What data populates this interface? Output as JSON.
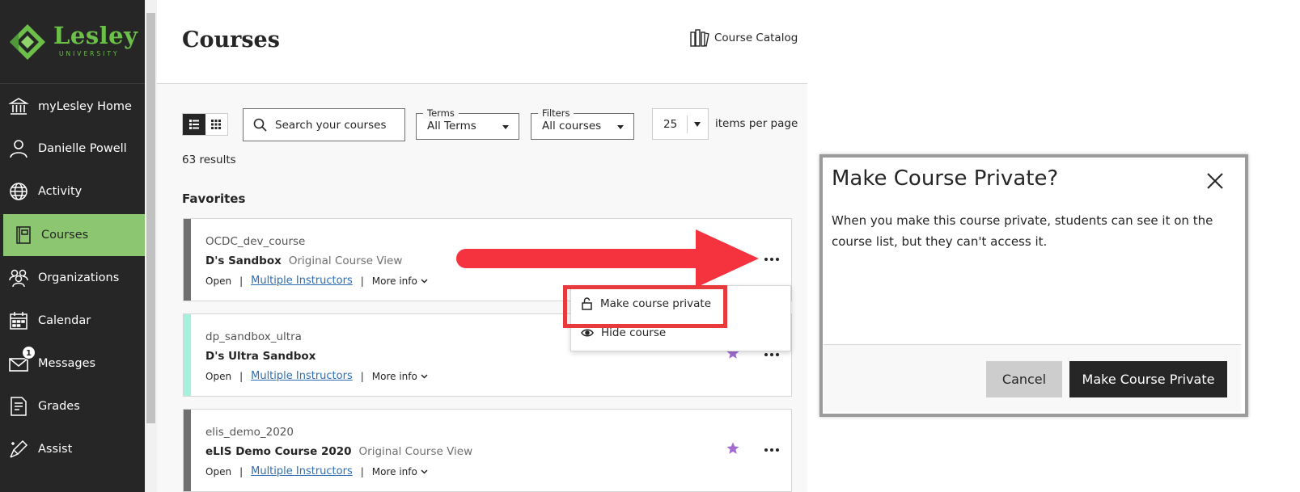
{
  "brand": {
    "name": "Lesley",
    "subname": "UNIVERSITY",
    "accent": "#6cc04a"
  },
  "sidebar": {
    "items": [
      {
        "label": "myLesley Home",
        "icon": "institution-icon"
      },
      {
        "label": "Danielle Powell",
        "icon": "user-icon"
      },
      {
        "label": "Activity",
        "icon": "globe-icon"
      },
      {
        "label": "Courses",
        "icon": "book-icon",
        "active": true
      },
      {
        "label": "Organizations",
        "icon": "group-icon"
      },
      {
        "label": "Calendar",
        "icon": "calendar-icon"
      },
      {
        "label": "Messages",
        "icon": "envelope-icon",
        "badge": "1"
      },
      {
        "label": "Grades",
        "icon": "grades-icon"
      },
      {
        "label": "Assist",
        "icon": "assist-icon"
      }
    ],
    "active_color": "#8dc670"
  },
  "main": {
    "title": "Courses",
    "catalog_label": "Course Catalog",
    "search_placeholder": "Search your courses",
    "terms": {
      "legend": "Terms",
      "value": "All Terms"
    },
    "filters": {
      "legend": "Filters",
      "value": "All courses"
    },
    "per_page": {
      "value": "25",
      "label": "items per page"
    },
    "results": "63 results",
    "section": "Favorites",
    "courses": [
      {
        "id": "OCDC_dev_course",
        "name": "D's Sandbox",
        "view": "Original Course View",
        "status": "Open",
        "instructors": "Multiple Instructors",
        "more": "More info",
        "stripe": "#6f6f6f"
      },
      {
        "id": "dp_sandbox_ultra",
        "name": "D's Ultra Sandbox",
        "view": "",
        "status": "Open",
        "instructors": "Multiple Instructors",
        "more": "More info",
        "stripe": "#a6f0de"
      },
      {
        "id": "elis_demo_2020",
        "name": "eLIS Demo Course 2020",
        "view": "Original Course View",
        "status": "Open",
        "instructors": "Multiple Instructors",
        "more": "More info",
        "stripe": "#6f6f6f"
      }
    ],
    "menu": {
      "items": [
        {
          "label": "Make course private",
          "icon": "unlock-icon"
        },
        {
          "label": "Hide course",
          "icon": "eye-icon"
        }
      ]
    }
  },
  "dialog": {
    "title": "Make Course Private?",
    "body": "When you make this course private, students can see it on the course list, but they can't access it.",
    "cancel": "Cancel",
    "confirm": "Make Course Private"
  },
  "colors": {
    "annotation": "#e83a3d",
    "star": "#a26cd0",
    "link": "#2e6db4"
  }
}
